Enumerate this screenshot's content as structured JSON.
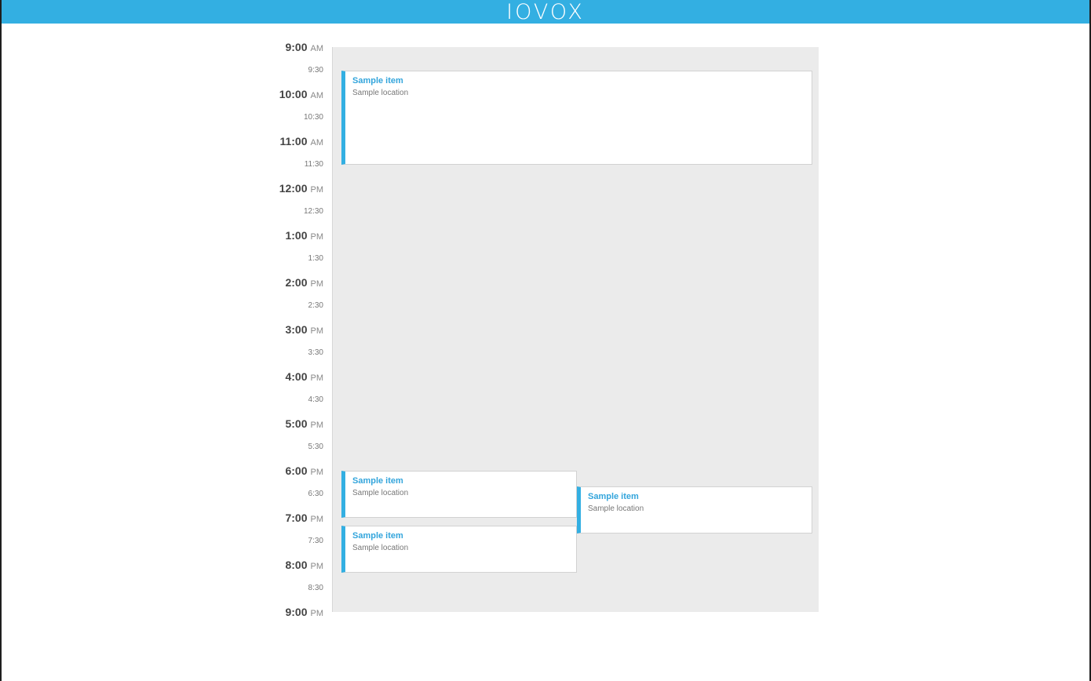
{
  "header": {
    "brand": "IOVOX",
    "brand_color": "#33afe2"
  },
  "timeline": {
    "slots": [
      {
        "hour": "9:00",
        "ampm": "AM"
      },
      {
        "half": "9:30"
      },
      {
        "hour": "10:00",
        "ampm": "AM"
      },
      {
        "half": "10:30"
      },
      {
        "hour": "11:00",
        "ampm": "AM"
      },
      {
        "half": "11:30"
      },
      {
        "hour": "12:00",
        "ampm": "PM"
      },
      {
        "half": "12:30"
      },
      {
        "hour": "1:00",
        "ampm": "PM"
      },
      {
        "half": "1:30"
      },
      {
        "hour": "2:00",
        "ampm": "PM"
      },
      {
        "half": "2:30"
      },
      {
        "hour": "3:00",
        "ampm": "PM"
      },
      {
        "half": "3:30"
      },
      {
        "hour": "4:00",
        "ampm": "PM"
      },
      {
        "half": "4:30"
      },
      {
        "hour": "5:00",
        "ampm": "PM"
      },
      {
        "half": "5:30"
      },
      {
        "hour": "6:00",
        "ampm": "PM"
      },
      {
        "half": "6:30"
      },
      {
        "hour": "7:00",
        "ampm": "PM"
      },
      {
        "half": "7:30"
      },
      {
        "hour": "8:00",
        "ampm": "PM"
      },
      {
        "half": "8:30"
      },
      {
        "hour": "9:00",
        "ampm": "PM"
      }
    ]
  },
  "events": [
    {
      "title": "Sample item",
      "location": "Sample location"
    },
    {
      "title": "Sample item",
      "location": "Sample location"
    },
    {
      "title": "Sample item",
      "location": "Sample location"
    },
    {
      "title": "Sample item",
      "location": "Sample location"
    }
  ]
}
